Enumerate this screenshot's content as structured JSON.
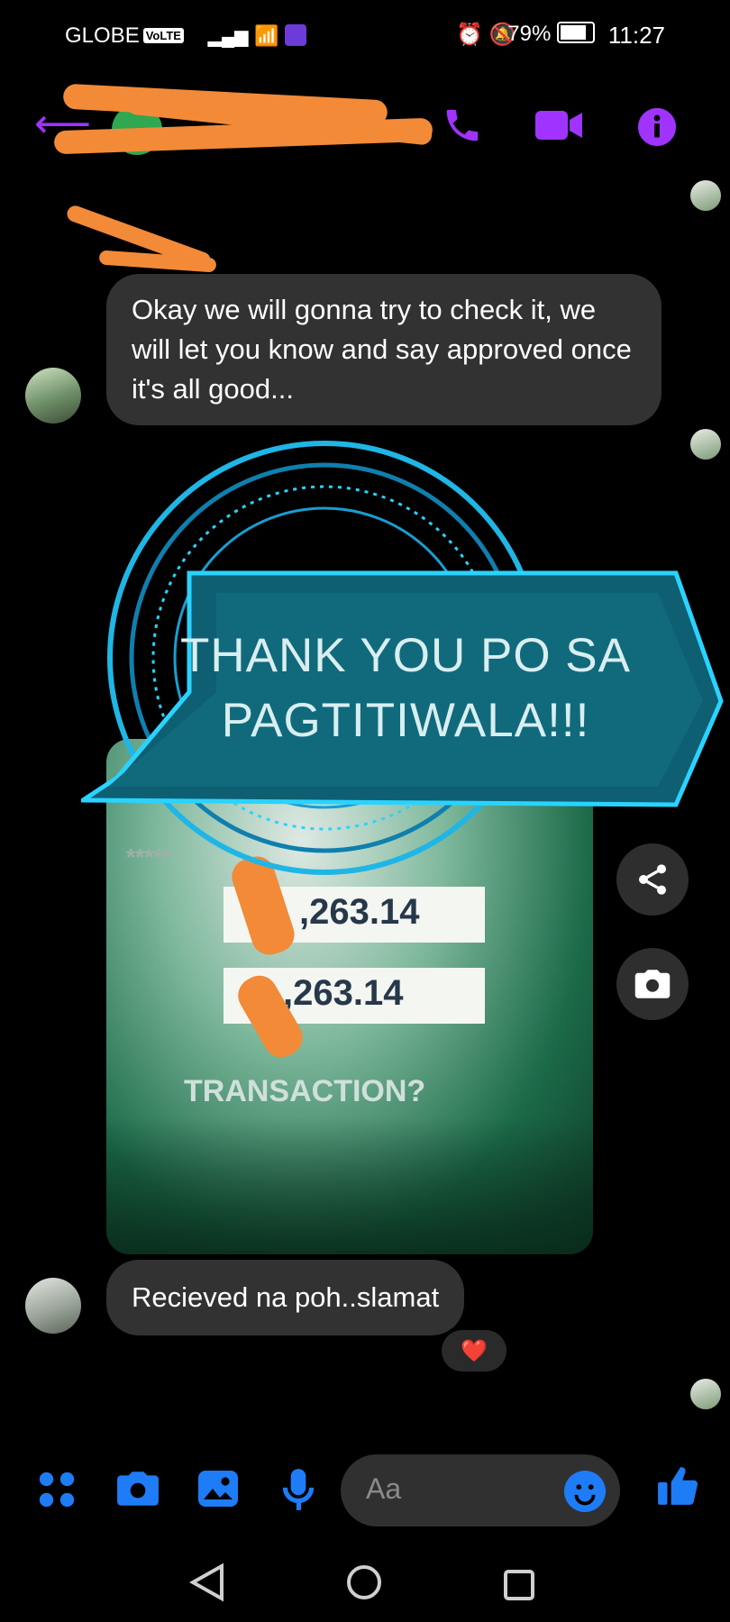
{
  "status_bar": {
    "carrier": "GLOBE",
    "volte_badge": "VoLTE",
    "battery": "79%",
    "time": "11:27"
  },
  "header": {
    "back_icon": "back-arrow-icon",
    "call_icon": "phone-icon",
    "video_icon": "video-camera-icon",
    "info_icon": "info-icon",
    "accent_color": "#a033ff"
  },
  "messages": [
    {
      "sender": "other",
      "text": "Okay we will gonna try to check it, we will let you know and say approved once it's all good..."
    },
    {
      "sender": "other",
      "type": "image",
      "banner_line1": "THANK YOU PO SA",
      "banner_line2": "PAGTITIWALA!!!",
      "masked_text": "*****",
      "amount1": ",263.14",
      "amount2": ",263.14",
      "bottom_text": "TRANSACTION?"
    },
    {
      "sender": "other",
      "text": "Recieved na poh..slamat",
      "reaction": "❤️"
    }
  ],
  "composer": {
    "placeholder": "Aa",
    "tool_color": "#1e7cf6"
  }
}
